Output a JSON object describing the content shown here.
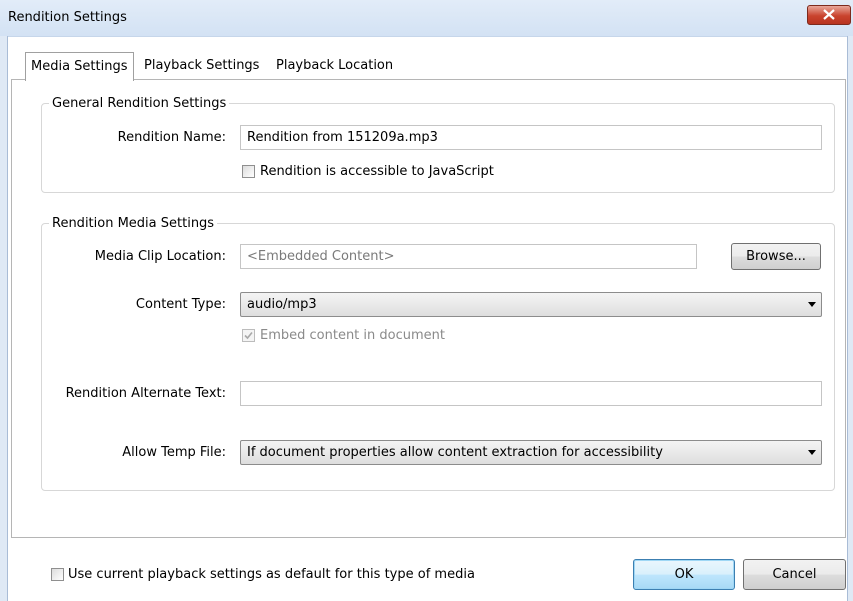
{
  "window": {
    "title": "Rendition Settings"
  },
  "tabs": [
    {
      "label": "Media Settings"
    },
    {
      "label": "Playback Settings"
    },
    {
      "label": "Playback Location"
    }
  ],
  "general": {
    "title": "General Rendition Settings",
    "rendition_name_label": "Rendition Name:",
    "rendition_name_value": "Rendition from 151209a.mp3",
    "js_accessible_label": "Rendition is accessible to JavaScript",
    "js_accessible_checked": false
  },
  "media": {
    "title": "Rendition Media Settings",
    "clip_location_label": "Media Clip Location:",
    "clip_location_value": "<Embedded Content>",
    "browse_label": "Browse...",
    "content_type_label": "Content Type:",
    "content_type_value": "audio/mp3",
    "embed_label": "Embed content in document",
    "embed_checked": true,
    "alt_text_label": "Rendition Alternate Text:",
    "alt_text_value": "",
    "temp_file_label": "Allow Temp File:",
    "temp_file_value": "If document properties allow content extraction for accessibility"
  },
  "footer": {
    "default_checkbox_label": "Use current playback settings as default for this type of media",
    "default_checked": false,
    "ok_label": "OK",
    "cancel_label": "Cancel"
  }
}
